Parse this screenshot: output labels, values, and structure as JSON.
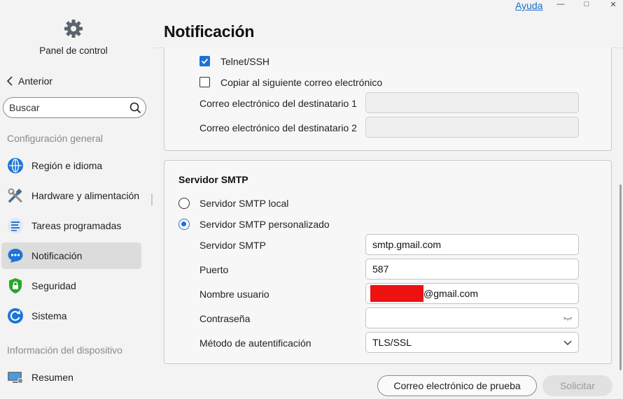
{
  "sidebar": {
    "brand_label": "Panel de control",
    "back_label": "Anterior",
    "search_placeholder": "Buscar",
    "section_general": "Configuración general",
    "section_device": "Información del dispositivo",
    "items": [
      {
        "label": "Región e idioma",
        "icon": "globe-icon"
      },
      {
        "label": "Hardware y alimentación",
        "icon": "tools-icon"
      },
      {
        "label": "Tareas programadas",
        "icon": "tasks-icon"
      },
      {
        "label": "Notificación",
        "icon": "chat-bubble-icon",
        "active": true
      },
      {
        "label": "Seguridad",
        "icon": "shield-lock-icon"
      },
      {
        "label": "Sistema",
        "icon": "system-refresh-icon"
      }
    ],
    "device_items": [
      {
        "label": "Resumen",
        "icon": "monitor-icon"
      }
    ]
  },
  "titlebar": {
    "help_label": "Ayuda",
    "minimize": "—",
    "maximize": "□",
    "close": "✕"
  },
  "page": {
    "title": "Notificación"
  },
  "email_panel": {
    "telnet_label": "Telnet/SSH",
    "telnet_checked": true,
    "copy_label": "Copiar al siguiente correo electrónico",
    "copy_checked": false,
    "recipient1_label": "Correo electrónico del destinatario 1",
    "recipient1_value": "",
    "recipient2_label": "Correo electrónico del destinatario 2",
    "recipient2_value": ""
  },
  "smtp_panel": {
    "title": "Servidor SMTP",
    "local_label": "Servidor SMTP local",
    "custom_label": "Servidor SMTP personalizado",
    "selected": "custom",
    "server_label": "Servidor SMTP",
    "server_value": "smtp.gmail.com",
    "port_label": "Puerto",
    "port_value": "587",
    "username_label": "Nombre usuario",
    "username_suffix": "@gmail.com",
    "password_label": "Contraseña",
    "password_value": "",
    "auth_label": "Método de autentificación",
    "auth_value": "TLS/SSL"
  },
  "footer": {
    "test_button": "Correo electrónico de prueba",
    "apply_button": "Solicitar"
  },
  "colors": {
    "accent": "#1a73d8",
    "redaction": "#ee1111"
  }
}
